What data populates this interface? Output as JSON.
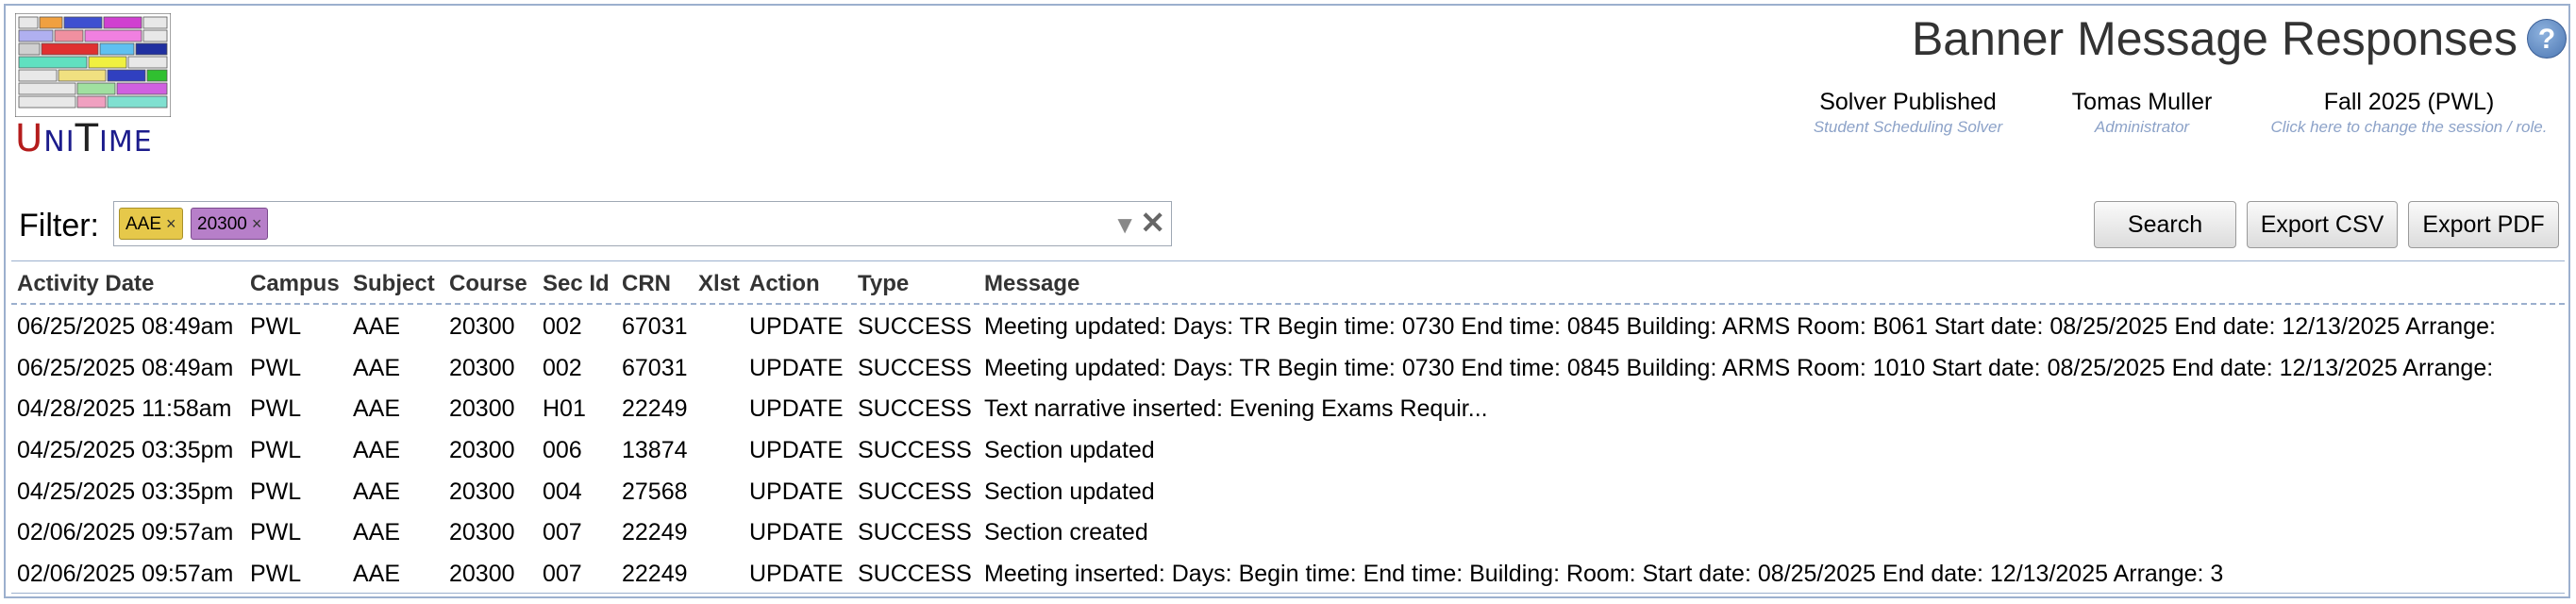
{
  "app": {
    "logo_text": "UniTime"
  },
  "header": {
    "title": "Banner Message Responses",
    "help_icon": "?",
    "solver": {
      "main": "Solver Published",
      "sub": "Student Scheduling Solver"
    },
    "user": {
      "main": "Tomas Muller",
      "sub": "Administrator"
    },
    "session": {
      "main": "Fall 2025 (PWL)",
      "sub": "Click here to change the session / role."
    }
  },
  "filter": {
    "label": "Filter:",
    "chips": [
      {
        "label": "AAE",
        "color": "#e6c84a"
      },
      {
        "label": "20300",
        "color": "#b77fc9"
      }
    ],
    "remove_glyph": "×",
    "dropdown_glyph": "▼",
    "clear_glyph": "✕"
  },
  "buttons": {
    "search": "Search",
    "export_csv": "Export CSV",
    "export_pdf": "Export PDF"
  },
  "table": {
    "columns": [
      "Activity Date",
      "Campus",
      "Subject",
      "Course",
      "Sec Id",
      "CRN",
      "Xlst",
      "Action",
      "Type",
      "Message"
    ],
    "rows": [
      [
        "06/25/2025 08:49am",
        "PWL",
        "AAE",
        "20300",
        "002",
        "67031",
        "",
        "UPDATE",
        "SUCCESS",
        "Meeting updated: Days: TR Begin time: 0730 End time: 0845 Building: ARMS Room: B061 Start date: 08/25/2025 End date: 12/13/2025 Arrange:"
      ],
      [
        "06/25/2025 08:49am",
        "PWL",
        "AAE",
        "20300",
        "002",
        "67031",
        "",
        "UPDATE",
        "SUCCESS",
        "Meeting updated: Days: TR Begin time: 0730 End time: 0845 Building: ARMS Room: 1010 Start date: 08/25/2025 End date: 12/13/2025 Arrange:"
      ],
      [
        "04/28/2025 11:58am",
        "PWL",
        "AAE",
        "20300",
        "H01",
        "22249",
        "",
        "UPDATE",
        "SUCCESS",
        "Text narrative inserted: Evening Exams Requir..."
      ],
      [
        "04/25/2025 03:35pm",
        "PWL",
        "AAE",
        "20300",
        "006",
        "13874",
        "",
        "UPDATE",
        "SUCCESS",
        "Section updated"
      ],
      [
        "04/25/2025 03:35pm",
        "PWL",
        "AAE",
        "20300",
        "004",
        "27568",
        "",
        "UPDATE",
        "SUCCESS",
        "Section updated"
      ],
      [
        "02/06/2025 09:57am",
        "PWL",
        "AAE",
        "20300",
        "007",
        "22249",
        "",
        "UPDATE",
        "SUCCESS",
        "Section created"
      ],
      [
        "02/06/2025 09:57am",
        "PWL",
        "AAE",
        "20300",
        "007",
        "22249",
        "",
        "UPDATE",
        "SUCCESS",
        "Meeting inserted: Days: Begin time: End time: Building: Room: Start date: 08/25/2025 End date: 12/13/2025 Arrange: 3"
      ]
    ]
  }
}
